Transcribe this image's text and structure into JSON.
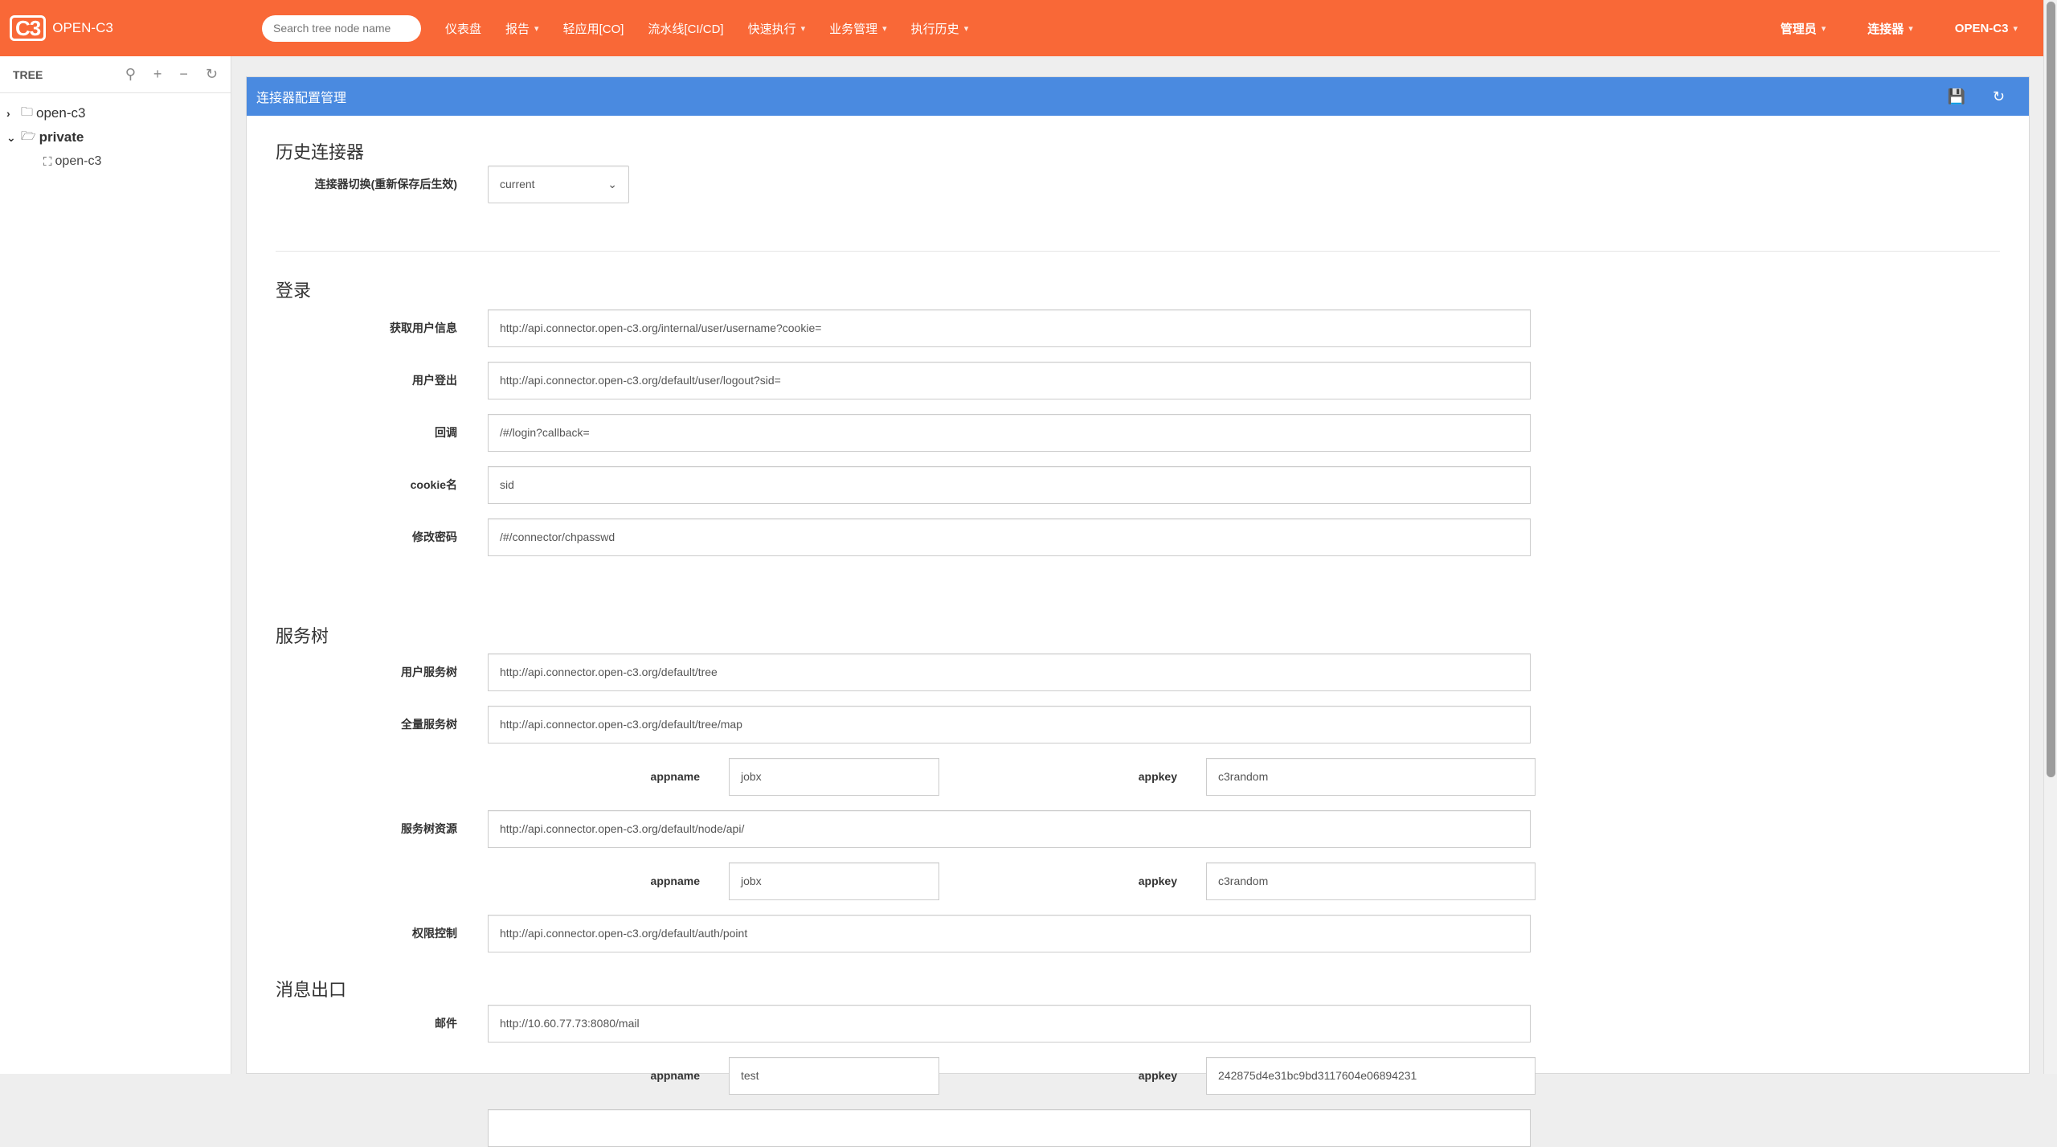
{
  "navbar": {
    "logo": "C3",
    "brand": "OPEN-C3",
    "search_placeholder": "Search tree node name",
    "menu": [
      {
        "label": "仪表盘",
        "caret": false
      },
      {
        "label": "报告",
        "caret": true
      },
      {
        "label": "轻应用[CO]",
        "caret": false
      },
      {
        "label": "流水线[CI/CD]",
        "caret": false
      },
      {
        "label": "快速执行",
        "caret": true
      },
      {
        "label": "业务管理",
        "caret": true
      },
      {
        "label": "执行历史",
        "caret": true
      }
    ],
    "right": [
      {
        "label": "管理员"
      },
      {
        "label": "连接器"
      },
      {
        "label": "OPEN-C3"
      }
    ]
  },
  "sidebar": {
    "title": "TREE",
    "nodes": [
      {
        "label": "open-c3"
      },
      {
        "label": "private"
      },
      {
        "label": "open-c3"
      }
    ]
  },
  "panel": {
    "title": "连接器配置管理"
  },
  "history": {
    "title": "历史连接器",
    "switch_label": "连接器切换(重新保存后生效)",
    "switch_value": "current"
  },
  "login": {
    "title": "登录",
    "fields": [
      {
        "label": "获取用户信息",
        "value": "http://api.connector.open-c3.org/internal/user/username?cookie="
      },
      {
        "label": "用户登出",
        "value": "http://api.connector.open-c3.org/default/user/logout?sid="
      },
      {
        "label": "回调",
        "value": "/#/login?callback="
      },
      {
        "label": "cookie名",
        "value": "sid"
      },
      {
        "label": "修改密码",
        "value": "/#/connector/chpasswd"
      }
    ]
  },
  "tree_service": {
    "title": "服务树",
    "user_tree": {
      "label": "用户服务树",
      "value": "http://api.connector.open-c3.org/default/tree"
    },
    "full_tree": {
      "label": "全量服务树",
      "value": "http://api.connector.open-c3.org/default/tree/map"
    },
    "full_tree_auth": {
      "appname_label": "appname",
      "appname": "jobx",
      "appkey_label": "appkey",
      "appkey": "c3random"
    },
    "resources": {
      "label": "服务树资源",
      "value": "http://api.connector.open-c3.org/default/node/api/"
    },
    "resources_auth": {
      "appname_label": "appname",
      "appname": "jobx",
      "appkey_label": "appkey",
      "appkey": "c3random"
    },
    "permission": {
      "label": "权限控制",
      "value": "http://api.connector.open-c3.org/default/auth/point"
    }
  },
  "message": {
    "title": "消息出口",
    "mail": {
      "label": "邮件",
      "value": "http://10.60.77.73:8080/mail"
    },
    "mail_auth": {
      "appname_label": "appname",
      "appname": "test",
      "appkey_label": "appkey",
      "appkey": "242875d4e31bc9bd3117604e06894231"
    }
  }
}
